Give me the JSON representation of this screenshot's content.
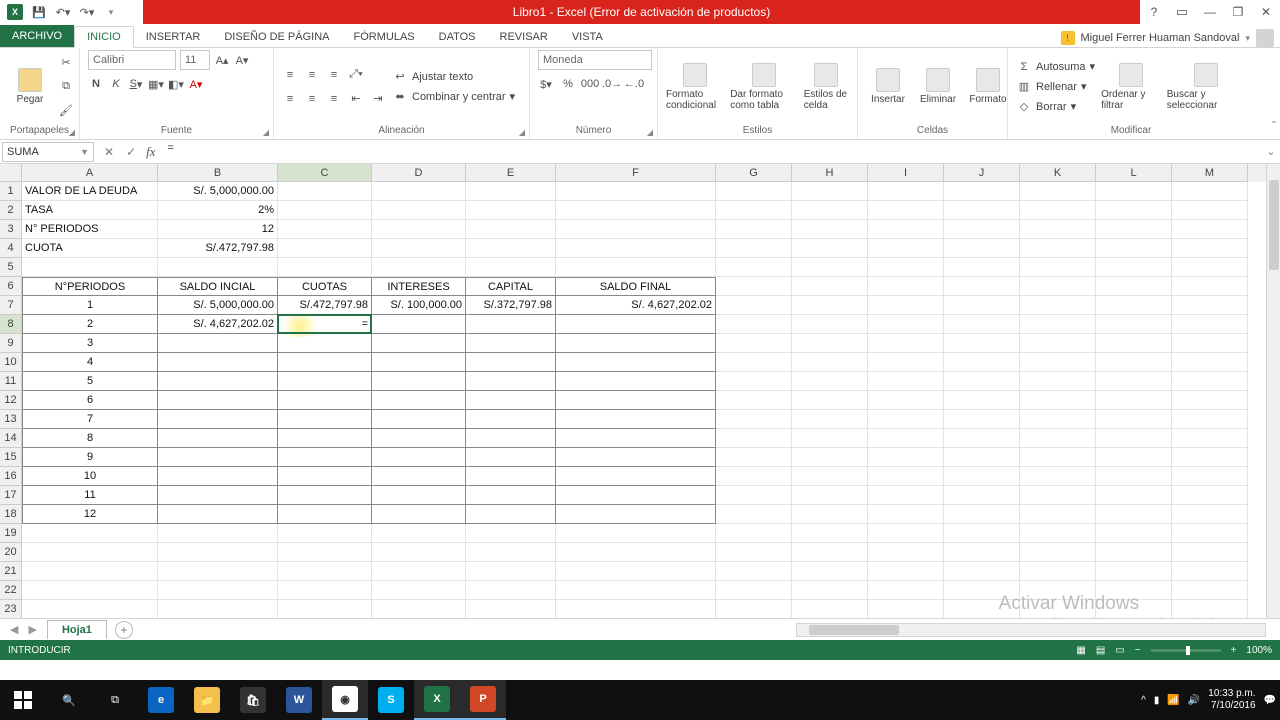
{
  "title": "Libro1 - Excel (Error de activación de productos)",
  "account": "Miguel Ferrer Huaman Sandoval",
  "tabs": {
    "file": "ARCHIVO",
    "inicio": "INICIO",
    "insertar": "INSERTAR",
    "diseno": "DISEÑO DE PÁGINA",
    "formulas": "FÓRMULAS",
    "datos": "DATOS",
    "revisar": "REVISAR",
    "vista": "VISTA"
  },
  "ribbon": {
    "portapapeles": {
      "pegar": "Pegar",
      "label": "Portapapeles"
    },
    "fuente": {
      "name": "Calibri",
      "size": "11",
      "label": "Fuente"
    },
    "alineacion": {
      "ajustar": "Ajustar texto",
      "combinar": "Combinar y centrar",
      "label": "Alineación"
    },
    "numero": {
      "format": "Moneda",
      "label": "Número"
    },
    "estilos": {
      "cond": "Formato condicional",
      "tabla": "Dar formato como tabla",
      "celda": "Estilos de celda",
      "label": "Estilos"
    },
    "celdas": {
      "insertar": "Insertar",
      "eliminar": "Eliminar",
      "formato": "Formato",
      "label": "Celdas"
    },
    "modificar": {
      "autosuma": "Autosuma",
      "rellenar": "Rellenar",
      "borrar": "Borrar",
      "ordenar": "Ordenar y filtrar",
      "buscar": "Buscar y seleccionar",
      "label": "Modificar"
    }
  },
  "namebox": "SUMA",
  "formula": "=",
  "columns": [
    "A",
    "B",
    "C",
    "D",
    "E",
    "F",
    "G",
    "H",
    "I",
    "J",
    "K",
    "L",
    "M"
  ],
  "cells": {
    "A1": "VALOR DE LA DEUDA",
    "B1": "S/.    5,000,000.00",
    "A2": "TASA",
    "B2": "2%",
    "A3": "N° PERIODOS",
    "B3": "12",
    "A4": "CUOTA",
    "B4": "S/.472,797.98",
    "A6": "N°PERIODOS",
    "B6": "SALDO INCIAL",
    "C6": "CUOTAS",
    "D6": "INTERESES",
    "E6": "CAPITAL",
    "F6": "SALDO FINAL",
    "A7": "1",
    "B7": "S/.    5,000,000.00",
    "C7": "S/.472,797.98",
    "D7": "S/.   100,000.00",
    "E7": "S/.372,797.98",
    "F7": "S/.              4,627,202.02",
    "A8": "2",
    "B8": "S/.    4,627,202.02",
    "C8": "=",
    "A9": "3",
    "A10": "4",
    "A11": "5",
    "A12": "6",
    "A13": "7",
    "A14": "8",
    "A15": "9",
    "A16": "10",
    "A17": "11",
    "A18": "12"
  },
  "sheet": "Hoja1",
  "status": "INTRODUCIR",
  "zoom": "100%",
  "watermark": {
    "t1": "Activar Windows",
    "t2": "Ve a Configuración para activar Windows."
  },
  "tray": {
    "time": "10:33 p.m.",
    "date": "7/10/2016"
  }
}
